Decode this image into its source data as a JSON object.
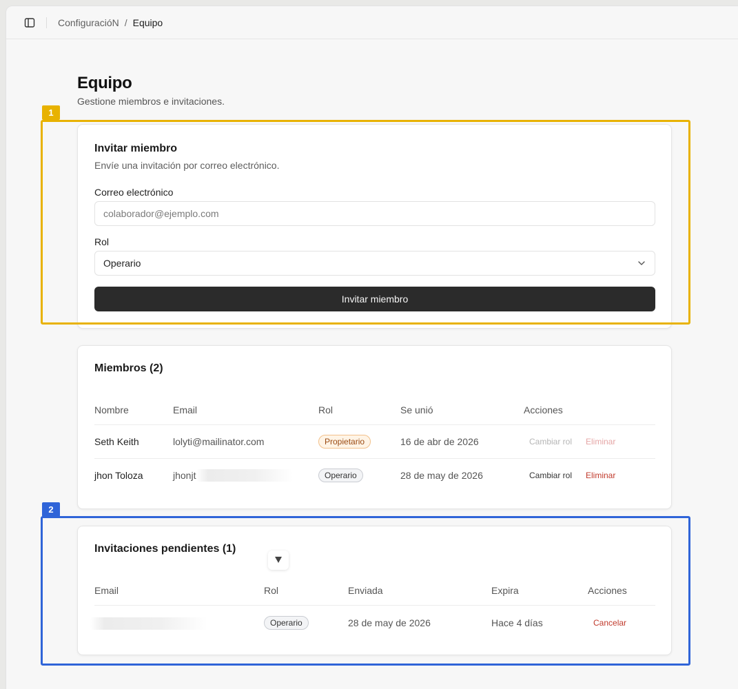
{
  "breadcrumb": {
    "parent": "ConfiguracióN",
    "separator": "/",
    "current": "Equipo"
  },
  "page": {
    "title": "Equipo",
    "subtitle": "Gestione miembros e invitaciones."
  },
  "invite": {
    "title": "Invitar miembro",
    "subtitle": "Envíe una invitación por correo electrónico.",
    "email_label": "Correo electrónico",
    "email_placeholder": "colaborador@ejemplo.com",
    "email_value": "",
    "role_label": "Rol",
    "role_value": "Operario",
    "submit_label": "Invitar miembro"
  },
  "members": {
    "title": "Miembros (2)",
    "columns": [
      "Nombre",
      "Email",
      "Rol",
      "Se unió",
      "Acciones"
    ],
    "rows": [
      {
        "name": "Seth Keith",
        "email": "lolyti@mailinator.com",
        "role": "Propietario",
        "joined": "16 de abr de 2026",
        "change_role": "Cambiar rol",
        "remove": "Eliminar",
        "actions_disabled": true
      },
      {
        "name": "jhon Toloza",
        "email": "jhonjt",
        "role": "Operario",
        "joined": "28 de may de 2026",
        "change_role": "Cambiar rol",
        "remove": "Eliminar",
        "actions_disabled": false
      }
    ]
  },
  "invitations": {
    "title": "Invitaciones pendientes (1)",
    "columns": [
      "Email",
      "Rol",
      "Enviada",
      "Expira",
      "Acciones"
    ],
    "rows": [
      {
        "email": "",
        "role": "Operario",
        "sent": "28 de may de 2026",
        "expires": "Hace 4 días",
        "cancel": "Cancelar"
      }
    ]
  },
  "annotations": [
    {
      "label": "1",
      "color": "#e8b200"
    },
    {
      "label": "2",
      "color": "#2f64d8"
    }
  ],
  "colors": {
    "primary_button": "#2b2b2b",
    "danger": "#c0392b",
    "owner_badge": "#fff4e6"
  }
}
